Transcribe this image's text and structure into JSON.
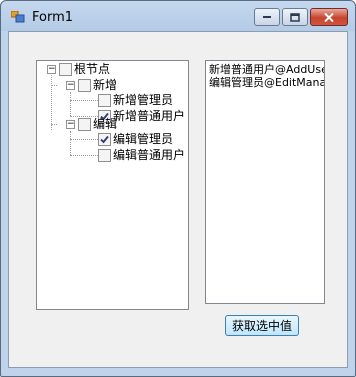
{
  "window": {
    "title": "Form1"
  },
  "tree": {
    "root": {
      "label": "根节点",
      "checked": false,
      "expanded": true
    },
    "groups": [
      {
        "label": "新增",
        "checked": false,
        "expanded": true,
        "children": [
          {
            "label": "新增管理员",
            "checked": false
          },
          {
            "label": "新增普通用户",
            "checked": true
          }
        ]
      },
      {
        "label": "编辑",
        "checked": false,
        "expanded": true,
        "children": [
          {
            "label": "编辑管理员",
            "checked": true
          },
          {
            "label": "编辑普通用户",
            "checked": false
          }
        ]
      }
    ]
  },
  "list": {
    "items": [
      "新增普通用户@AddUse",
      "编辑管理员@EditMana"
    ]
  },
  "button": {
    "label": "获取选中值"
  }
}
